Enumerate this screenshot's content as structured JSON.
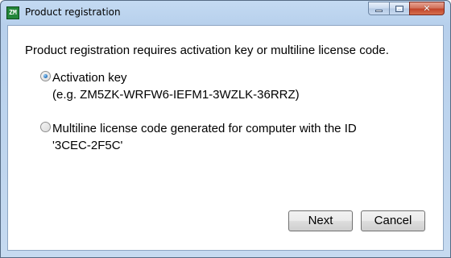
{
  "window": {
    "title": "Product registration",
    "app_icon_text": "ZM"
  },
  "message": "Product registration requires activation key or multiline license code.",
  "options": {
    "activation": {
      "label": "Activation key",
      "detail": "(e.g. ZM5ZK-WRFW6-IEFM1-3WZLK-36RRZ)",
      "selected": true
    },
    "multiline": {
      "label": "Multiline license code generated for computer with the ID",
      "detail": "'3CEC-2F5C'",
      "selected": false
    }
  },
  "buttons": {
    "next_label": "Next",
    "cancel_label": "Cancel"
  },
  "caption": {
    "close_glyph": "✕"
  }
}
